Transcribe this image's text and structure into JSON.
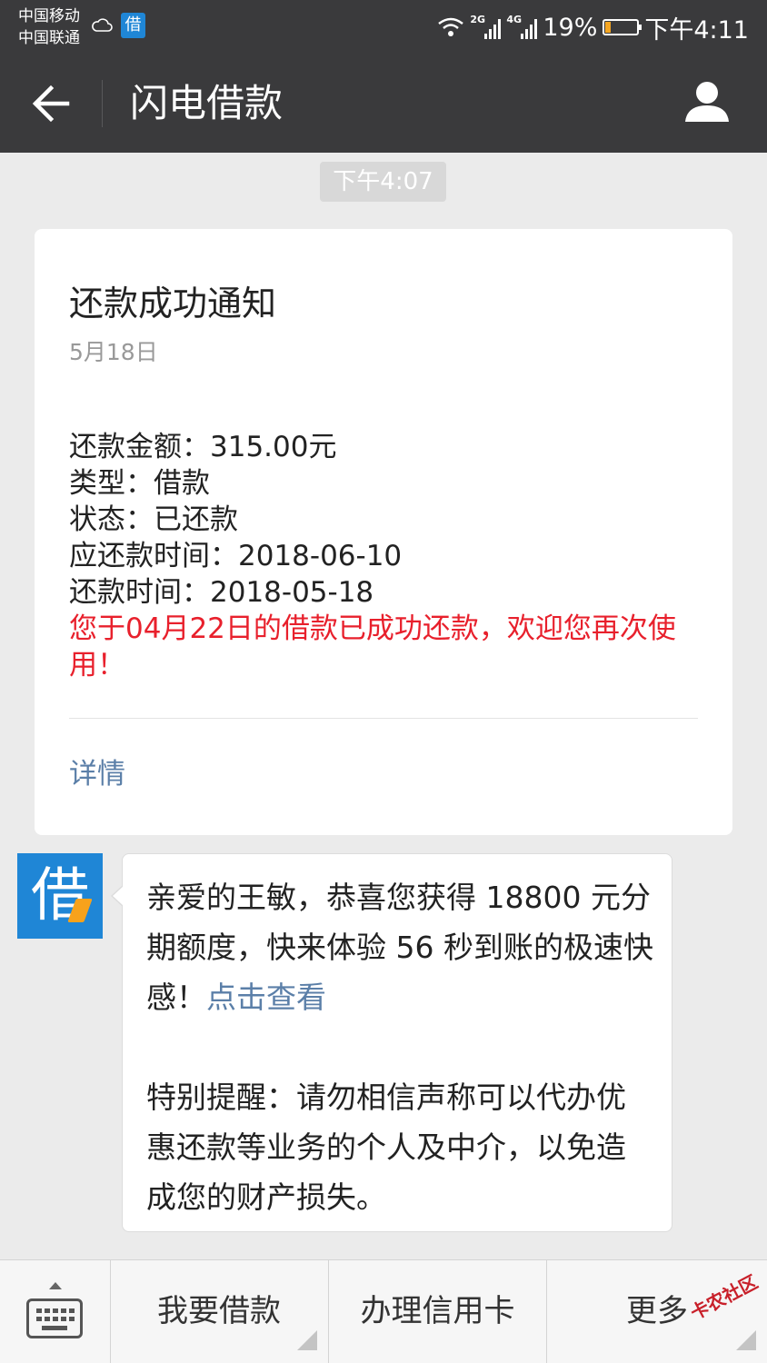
{
  "status_bar": {
    "carrier_1": "中国移动",
    "carrier_2": "中国联通",
    "app_badge": "借",
    "net_1": "2G",
    "net_2": "4G",
    "battery": "19%",
    "time": "下午4:11"
  },
  "header": {
    "title": "闪电借款"
  },
  "chat": {
    "timestamp": "下午4:07",
    "card": {
      "title": "还款成功通知",
      "date": "5月18日",
      "lines": [
        "还款金额：315.00元",
        "类型：借款",
        "状态：已还款",
        "应还款时间：2018-06-10",
        "还款时间：2018-05-18"
      ],
      "highlight": "您于04月22日的借款已成功还款，欢迎您再次使用！",
      "details_label": "详情"
    },
    "message": {
      "avatar_char": "借",
      "text_1": "亲爱的王敏，恭喜您获得 18800 元分期额度，快来体验 56 秒到账的极速快感！",
      "link_label": "点击查看",
      "text_2": "特别提醒：请勿相信声称可以代办优惠还款等业务的个人及中介，以免造成您的财产损失。"
    }
  },
  "menu": {
    "items": [
      {
        "label": "我要借款"
      },
      {
        "label": "办理信用卡"
      },
      {
        "label": "更多"
      }
    ]
  },
  "watermark": "卡农社区",
  "colors": {
    "bar_bg": "#3a3a3c",
    "chat_bg": "#ebebeb",
    "highlight_red": "#e8202c",
    "link_blue": "#5b7fa8",
    "brand_blue": "#1f86d6"
  }
}
